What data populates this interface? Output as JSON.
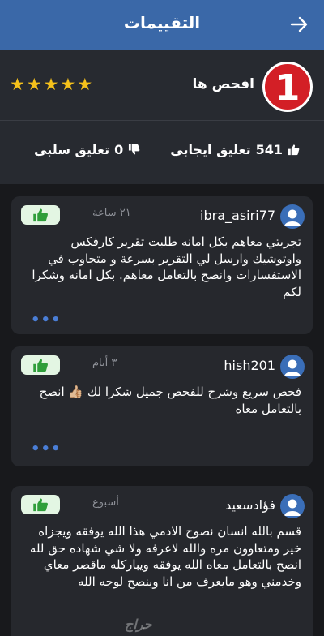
{
  "header": {
    "title": "التقييمات",
    "back_icon": "arrow-right-icon"
  },
  "shop": {
    "name": "افحص ها",
    "logo_text": "1",
    "rating": 5,
    "stars": [
      "★",
      "★",
      "★",
      "★",
      "★"
    ]
  },
  "stats": {
    "positive_count": "541",
    "positive_label": "تعليق ايجابي",
    "negative_count": "0",
    "negative_label": "تعليق سلبي"
  },
  "reviews": [
    {
      "user": "ibra_asiri77",
      "time": "٢١ ساعة",
      "text": "تجربتي معاهم بكل امانه طلبت تقرير كارفكس واوتوشيك وارسل لي التقرير بسرعة و متجاوب في الاستفسارات وانصح بالتعامل معاهم. بكل امانه وشكرا لكم",
      "more": "•••"
    },
    {
      "user": "hish201",
      "time": "٣ أيام",
      "text": "فحص سريع وشرح للفحص جميل شكرا لك 👍🏼 انصح بالتعامل معاه",
      "more": "•••"
    },
    {
      "user": "فؤادسعيد",
      "time": "أسبوع",
      "text": "قسم بالله انسان نصوح الادمي هذا الله يوفقه ويجزاه خير ومتعاوون مره والله لاعرفه ولا شي شهاده حق لله انصح بالتعامل معاه الله يوفقه ويباركله ماقصر معاي وخدمني وهو مايعرف من انا وينصح لوجه الله"
    }
  ],
  "watermark": "حراج",
  "colors": {
    "header": "#3a68a8",
    "star": "#f6c21b",
    "logo_red": "#d31f26",
    "like_bg": "#e3f6e3",
    "like_icon": "#2f9e3a",
    "more_dots": "#4a7ed6"
  }
}
